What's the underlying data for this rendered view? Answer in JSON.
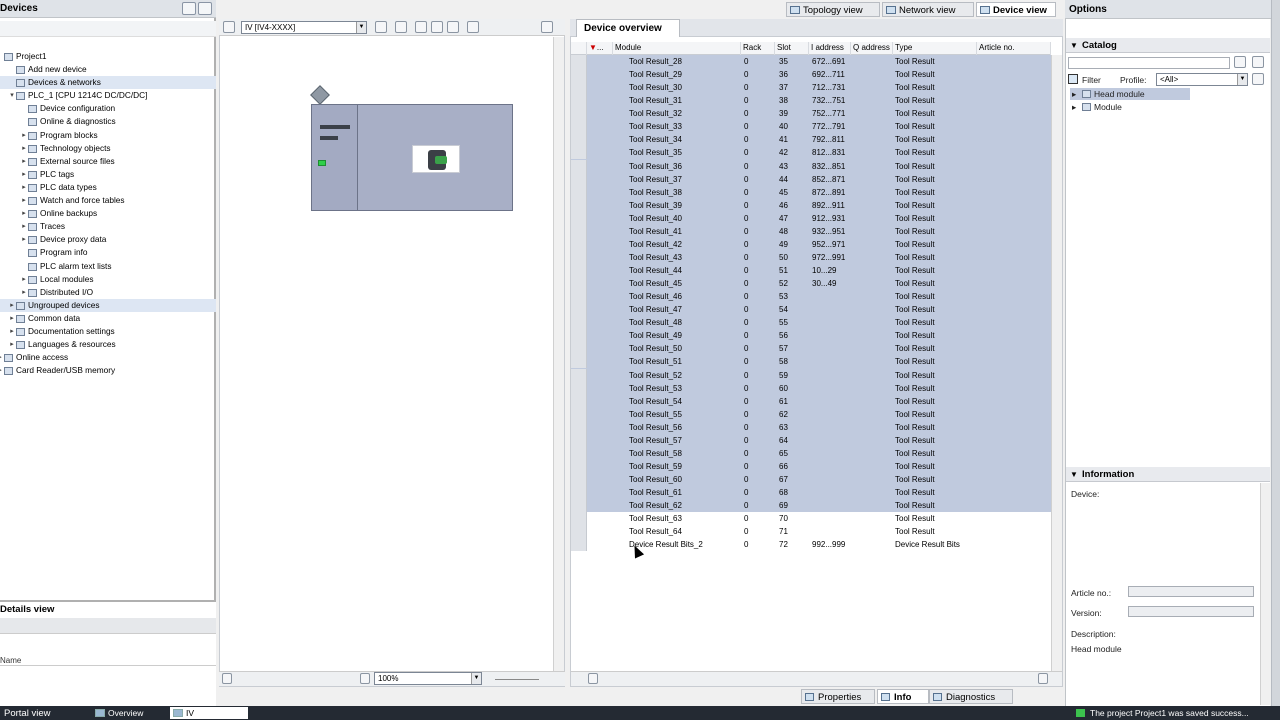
{
  "left_panel": {
    "title": "Devices",
    "tree": [
      {
        "label": "Project1",
        "level": 0,
        "arrow": "",
        "selected": false
      },
      {
        "label": "Add new device",
        "level": 1,
        "arrow": "",
        "selected": false
      },
      {
        "label": "Devices & networks",
        "level": 1,
        "arrow": "",
        "selected": true
      },
      {
        "label": "PLC_1 [CPU 1214C DC/DC/DC]",
        "level": 1,
        "arrow": "▾",
        "selected": false
      },
      {
        "label": "Device configuration",
        "level": 2,
        "arrow": "",
        "selected": false
      },
      {
        "label": "Online & diagnostics",
        "level": 2,
        "arrow": "",
        "selected": false
      },
      {
        "label": "Program blocks",
        "level": 2,
        "arrow": "▸",
        "selected": false
      },
      {
        "label": "Technology objects",
        "level": 2,
        "arrow": "▸",
        "selected": false
      },
      {
        "label": "External source files",
        "level": 2,
        "arrow": "▸",
        "selected": false
      },
      {
        "label": "PLC tags",
        "level": 2,
        "arrow": "▸",
        "selected": false
      },
      {
        "label": "PLC data types",
        "level": 2,
        "arrow": "▸",
        "selected": false
      },
      {
        "label": "Watch and force tables",
        "level": 2,
        "arrow": "▸",
        "selected": false
      },
      {
        "label": "Online backups",
        "level": 2,
        "arrow": "▸",
        "selected": false
      },
      {
        "label": "Traces",
        "level": 2,
        "arrow": "▸",
        "selected": false
      },
      {
        "label": "Device proxy data",
        "level": 2,
        "arrow": "▸",
        "selected": false
      },
      {
        "label": "Program info",
        "level": 2,
        "arrow": "",
        "selected": false
      },
      {
        "label": "PLC alarm text lists",
        "level": 2,
        "arrow": "",
        "selected": false
      },
      {
        "label": "Local modules",
        "level": 2,
        "arrow": "▸",
        "selected": false
      },
      {
        "label": "Distributed I/O",
        "level": 2,
        "arrow": "▸",
        "selected": false
      },
      {
        "label": "Ungrouped devices",
        "level": 1,
        "arrow": "▸",
        "selected": true
      },
      {
        "label": "Common data",
        "level": 1,
        "arrow": "▸",
        "selected": false
      },
      {
        "label": "Documentation settings",
        "level": 1,
        "arrow": "▸",
        "selected": false
      },
      {
        "label": "Languages & resources",
        "level": 1,
        "arrow": "▸",
        "selected": false
      },
      {
        "label": "Online access",
        "level": 0,
        "arrow": "▸",
        "selected": false
      },
      {
        "label": "Card Reader/USB memory",
        "level": 0,
        "arrow": "▸",
        "selected": false
      }
    ],
    "details_title": "Details view",
    "details_col": "Name"
  },
  "view_tabs": [
    "Topology view",
    "Network view",
    "Device view"
  ],
  "device_view": {
    "device_select": "IV [IV4-XXXX]",
    "zoom": "100%"
  },
  "overview": {
    "tab": "Device overview",
    "columns": [
      "...",
      "Module",
      "Rack",
      "Slot",
      "I address",
      "Q address",
      "Type",
      "Article no."
    ],
    "rows": [
      {
        "m": "Tool Result_28",
        "r": "0",
        "s": "35",
        "i": "672...691",
        "t": "Tool Result",
        "sel": true
      },
      {
        "m": "Tool Result_29",
        "r": "0",
        "s": "36",
        "i": "692...711",
        "t": "Tool Result",
        "sel": true
      },
      {
        "m": "Tool Result_30",
        "r": "0",
        "s": "37",
        "i": "712...731",
        "t": "Tool Result",
        "sel": true
      },
      {
        "m": "Tool Result_31",
        "r": "0",
        "s": "38",
        "i": "732...751",
        "t": "Tool Result",
        "sel": true
      },
      {
        "m": "Tool Result_32",
        "r": "0",
        "s": "39",
        "i": "752...771",
        "t": "Tool Result",
        "sel": true
      },
      {
        "m": "Tool Result_33",
        "r": "0",
        "s": "40",
        "i": "772...791",
        "t": "Tool Result",
        "sel": true
      },
      {
        "m": "Tool Result_34",
        "r": "0",
        "s": "41",
        "i": "792...811",
        "t": "Tool Result",
        "sel": true
      },
      {
        "m": "Tool Result_35",
        "r": "0",
        "s": "42",
        "i": "812...831",
        "t": "Tool Result",
        "sel": true
      },
      {
        "m": "Tool Result_36",
        "r": "0",
        "s": "43",
        "i": "832...851",
        "t": "Tool Result",
        "sel": true
      },
      {
        "m": "Tool Result_37",
        "r": "0",
        "s": "44",
        "i": "852...871",
        "t": "Tool Result",
        "sel": true
      },
      {
        "m": "Tool Result_38",
        "r": "0",
        "s": "45",
        "i": "872...891",
        "t": "Tool Result",
        "sel": true
      },
      {
        "m": "Tool Result_39",
        "r": "0",
        "s": "46",
        "i": "892...911",
        "t": "Tool Result",
        "sel": true
      },
      {
        "m": "Tool Result_40",
        "r": "0",
        "s": "47",
        "i": "912...931",
        "t": "Tool Result",
        "sel": true
      },
      {
        "m": "Tool Result_41",
        "r": "0",
        "s": "48",
        "i": "932...951",
        "t": "Tool Result",
        "sel": true
      },
      {
        "m": "Tool Result_42",
        "r": "0",
        "s": "49",
        "i": "952...971",
        "t": "Tool Result",
        "sel": true
      },
      {
        "m": "Tool Result_43",
        "r": "0",
        "s": "50",
        "i": "972...991",
        "t": "Tool Result",
        "sel": true
      },
      {
        "m": "Tool Result_44",
        "r": "0",
        "s": "51",
        "i": "10...29",
        "t": "Tool Result",
        "sel": true
      },
      {
        "m": "Tool Result_45",
        "r": "0",
        "s": "52",
        "i": "30...49",
        "t": "Tool Result",
        "sel": true
      },
      {
        "m": "Tool Result_46",
        "r": "0",
        "s": "53",
        "i": "",
        "t": "Tool Result",
        "sel": true
      },
      {
        "m": "Tool Result_47",
        "r": "0",
        "s": "54",
        "i": "",
        "t": "Tool Result",
        "sel": true
      },
      {
        "m": "Tool Result_48",
        "r": "0",
        "s": "55",
        "i": "",
        "t": "Tool Result",
        "sel": true
      },
      {
        "m": "Tool Result_49",
        "r": "0",
        "s": "56",
        "i": "",
        "t": "Tool Result",
        "sel": true
      },
      {
        "m": "Tool Result_50",
        "r": "0",
        "s": "57",
        "i": "",
        "t": "Tool Result",
        "sel": true
      },
      {
        "m": "Tool Result_51",
        "r": "0",
        "s": "58",
        "i": "",
        "t": "Tool Result",
        "sel": true
      },
      {
        "m": "Tool Result_52",
        "r": "0",
        "s": "59",
        "i": "",
        "t": "Tool Result",
        "sel": true
      },
      {
        "m": "Tool Result_53",
        "r": "0",
        "s": "60",
        "i": "",
        "t": "Tool Result",
        "sel": true
      },
      {
        "m": "Tool Result_54",
        "r": "0",
        "s": "61",
        "i": "",
        "t": "Tool Result",
        "sel": true
      },
      {
        "m": "Tool Result_55",
        "r": "0",
        "s": "62",
        "i": "",
        "t": "Tool Result",
        "sel": true
      },
      {
        "m": "Tool Result_56",
        "r": "0",
        "s": "63",
        "i": "",
        "t": "Tool Result",
        "sel": true
      },
      {
        "m": "Tool Result_57",
        "r": "0",
        "s": "64",
        "i": "",
        "t": "Tool Result",
        "sel": true
      },
      {
        "m": "Tool Result_58",
        "r": "0",
        "s": "65",
        "i": "",
        "t": "Tool Result",
        "sel": true
      },
      {
        "m": "Tool Result_59",
        "r": "0",
        "s": "66",
        "i": "",
        "t": "Tool Result",
        "sel": true
      },
      {
        "m": "Tool Result_60",
        "r": "0",
        "s": "67",
        "i": "",
        "t": "Tool Result",
        "sel": true
      },
      {
        "m": "Tool Result_61",
        "r": "0",
        "s": "68",
        "i": "",
        "t": "Tool Result",
        "sel": true
      },
      {
        "m": "Tool Result_62",
        "r": "0",
        "s": "69",
        "i": "",
        "t": "Tool Result",
        "sel": true
      },
      {
        "m": "Tool Result_63",
        "r": "0",
        "s": "70",
        "i": "",
        "t": "Tool Result",
        "sel": false
      },
      {
        "m": "Tool Result_64",
        "r": "0",
        "s": "71",
        "i": "",
        "t": "Tool Result",
        "sel": false
      },
      {
        "m": "Device Result Bits_2",
        "r": "0",
        "s": "72",
        "i": "992...999",
        "t": "Device Result Bits",
        "sel": false
      }
    ]
  },
  "options": {
    "title": "Options",
    "catalog": "Catalog",
    "filter": "Filter",
    "profile_label": "Profile:",
    "profile_value": "<All>",
    "tree": [
      "Head module",
      "Module"
    ]
  },
  "information": {
    "title": "Information",
    "device_label": "Device:",
    "article_label": "Article no.:",
    "version_label": "Version:",
    "description_label": "Description:",
    "description_value": "Head module"
  },
  "bottom_tabs": [
    "Properties",
    "Info",
    "Diagnostics"
  ],
  "status_bar": {
    "portal": "Portal view",
    "tabs": [
      "Overview",
      "IV"
    ],
    "message": "The project Project1 was saved success..."
  },
  "colors": {
    "selection": "#c0cade",
    "status_bar": "#242a33",
    "accent": "#2fd04a"
  }
}
